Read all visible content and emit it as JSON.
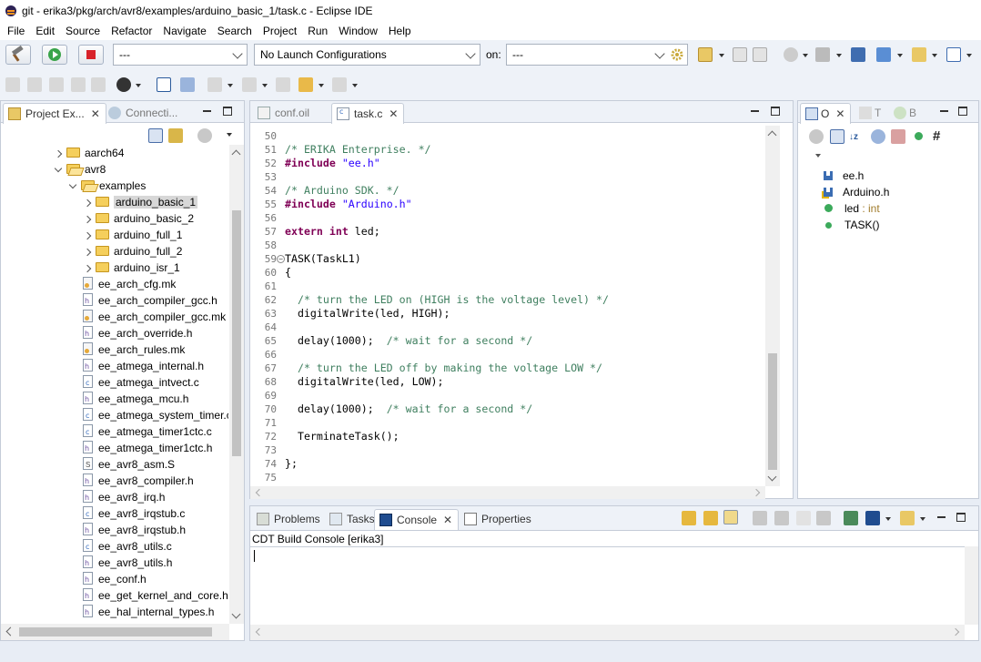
{
  "window": {
    "title": "git - erika3/pkg/arch/avr8/examples/arduino_basic_1/task.c - Eclipse IDE"
  },
  "menu": [
    "File",
    "Edit",
    "Source",
    "Refactor",
    "Navigate",
    "Search",
    "Project",
    "Run",
    "Window",
    "Help"
  ],
  "toolbar": {
    "launch_mode": "---",
    "launch_config": "No Launch Configurations",
    "on_label": "on:",
    "target": "---"
  },
  "project_explorer": {
    "tab_label": "Project Ex...",
    "tab2_label": "Connecti...",
    "items": [
      {
        "label": "aarch64",
        "kind": "folder",
        "level": 1,
        "state": "collapsed"
      },
      {
        "label": "avr8",
        "kind": "folder",
        "level": 1,
        "state": "open"
      },
      {
        "label": "examples",
        "kind": "folder",
        "level": 2,
        "state": "open"
      },
      {
        "label": "arduino_basic_1",
        "kind": "folder",
        "level": 3,
        "state": "collapsed",
        "selected": true
      },
      {
        "label": "arduino_basic_2",
        "kind": "folder",
        "level": 3,
        "state": "collapsed"
      },
      {
        "label": "arduino_full_1",
        "kind": "folder",
        "level": 3,
        "state": "collapsed"
      },
      {
        "label": "arduino_full_2",
        "kind": "folder",
        "level": 3,
        "state": "collapsed"
      },
      {
        "label": "arduino_isr_1",
        "kind": "folder",
        "level": 3,
        "state": "collapsed"
      },
      {
        "label": "ee_arch_cfg.mk",
        "kind": "mk",
        "level": 2
      },
      {
        "label": "ee_arch_compiler_gcc.h",
        "kind": "h",
        "level": 2
      },
      {
        "label": "ee_arch_compiler_gcc.mk",
        "kind": "mk",
        "level": 2
      },
      {
        "label": "ee_arch_override.h",
        "kind": "h",
        "level": 2
      },
      {
        "label": "ee_arch_rules.mk",
        "kind": "mk",
        "level": 2
      },
      {
        "label": "ee_atmega_internal.h",
        "kind": "h",
        "level": 2
      },
      {
        "label": "ee_atmega_intvect.c",
        "kind": "c",
        "level": 2
      },
      {
        "label": "ee_atmega_mcu.h",
        "kind": "h",
        "level": 2
      },
      {
        "label": "ee_atmega_system_timer.c",
        "kind": "c",
        "level": 2
      },
      {
        "label": "ee_atmega_timer1ctc.c",
        "kind": "c",
        "level": 2
      },
      {
        "label": "ee_atmega_timer1ctc.h",
        "kind": "h",
        "level": 2
      },
      {
        "label": "ee_avr8_asm.S",
        "kind": "s",
        "level": 2
      },
      {
        "label": "ee_avr8_compiler.h",
        "kind": "h",
        "level": 2
      },
      {
        "label": "ee_avr8_irq.h",
        "kind": "h",
        "level": 2
      },
      {
        "label": "ee_avr8_irqstub.c",
        "kind": "c",
        "level": 2
      },
      {
        "label": "ee_avr8_irqstub.h",
        "kind": "h",
        "level": 2
      },
      {
        "label": "ee_avr8_utils.c",
        "kind": "c",
        "level": 2
      },
      {
        "label": "ee_avr8_utils.h",
        "kind": "h",
        "level": 2
      },
      {
        "label": "ee_conf.h",
        "kind": "h",
        "level": 2
      },
      {
        "label": "ee_get_kernel_and_core.h",
        "kind": "h",
        "level": 2
      },
      {
        "label": "ee_hal_internal_types.h",
        "kind": "h",
        "level": 2
      }
    ]
  },
  "editor": {
    "tabs": [
      {
        "label": "conf.oil",
        "active": false
      },
      {
        "label": "task.c",
        "active": true
      }
    ],
    "lines": [
      {
        "n": "50",
        "parts": []
      },
      {
        "n": "51",
        "parts": [
          {
            "c": "cmt",
            "t": "/* ERIKA Enterprise. */"
          }
        ]
      },
      {
        "n": "52",
        "parts": [
          {
            "c": "kw",
            "t": "#include "
          },
          {
            "c": "str",
            "t": "\"ee.h\""
          }
        ]
      },
      {
        "n": "53",
        "parts": []
      },
      {
        "n": "54",
        "parts": [
          {
            "c": "cmt",
            "t": "/* Arduino SDK. */"
          }
        ]
      },
      {
        "n": "55",
        "parts": [
          {
            "c": "kw",
            "t": "#include "
          },
          {
            "c": "str",
            "t": "\"Arduino.h\""
          }
        ]
      },
      {
        "n": "56",
        "parts": []
      },
      {
        "n": "57",
        "parts": [
          {
            "c": "kw",
            "t": "extern int"
          },
          {
            "c": "plain",
            "t": " led;"
          }
        ]
      },
      {
        "n": "58",
        "parts": []
      },
      {
        "n": "59",
        "fold": true,
        "parts": [
          {
            "c": "plain",
            "t": "TASK(TaskL1)"
          }
        ]
      },
      {
        "n": "60",
        "parts": [
          {
            "c": "plain",
            "t": "{"
          }
        ]
      },
      {
        "n": "61",
        "parts": []
      },
      {
        "n": "62",
        "parts": [
          {
            "c": "cmt",
            "t": "  /* turn the LED on (HIGH is the voltage level) */"
          }
        ]
      },
      {
        "n": "63",
        "parts": [
          {
            "c": "plain",
            "t": "  digitalWrite(led, HIGH);"
          }
        ]
      },
      {
        "n": "64",
        "parts": []
      },
      {
        "n": "65",
        "parts": [
          {
            "c": "plain",
            "t": "  delay(1000);  "
          },
          {
            "c": "cmt",
            "t": "/* wait for a second */"
          }
        ]
      },
      {
        "n": "66",
        "parts": []
      },
      {
        "n": "67",
        "parts": [
          {
            "c": "cmt",
            "t": "  /* turn the LED off by making the voltage LOW */"
          }
        ]
      },
      {
        "n": "68",
        "parts": [
          {
            "c": "plain",
            "t": "  digitalWrite(led, LOW);"
          }
        ]
      },
      {
        "n": "69",
        "parts": []
      },
      {
        "n": "70",
        "parts": [
          {
            "c": "plain",
            "t": "  delay(1000);  "
          },
          {
            "c": "cmt",
            "t": "/* wait for a second */"
          }
        ]
      },
      {
        "n": "71",
        "parts": []
      },
      {
        "n": "72",
        "parts": [
          {
            "c": "plain",
            "t": "  TerminateTask();"
          }
        ]
      },
      {
        "n": "73",
        "parts": []
      },
      {
        "n": "74",
        "parts": [
          {
            "c": "plain",
            "t": "};"
          }
        ]
      },
      {
        "n": "75",
        "parts": []
      }
    ]
  },
  "outline": {
    "tabs": [
      "O",
      "T",
      "B"
    ],
    "items": [
      {
        "label": "ee.h",
        "kind": "include"
      },
      {
        "label": "Arduino.h",
        "kind": "include-warn"
      },
      {
        "label": "led",
        "type": " : int",
        "kind": "var"
      },
      {
        "label": "TASK()",
        "kind": "func"
      }
    ]
  },
  "bottom": {
    "tabs": [
      "Problems",
      "Tasks",
      "Console",
      "Properties"
    ],
    "active_tab": "Console",
    "console_title": "CDT Build Console [erika3]"
  }
}
